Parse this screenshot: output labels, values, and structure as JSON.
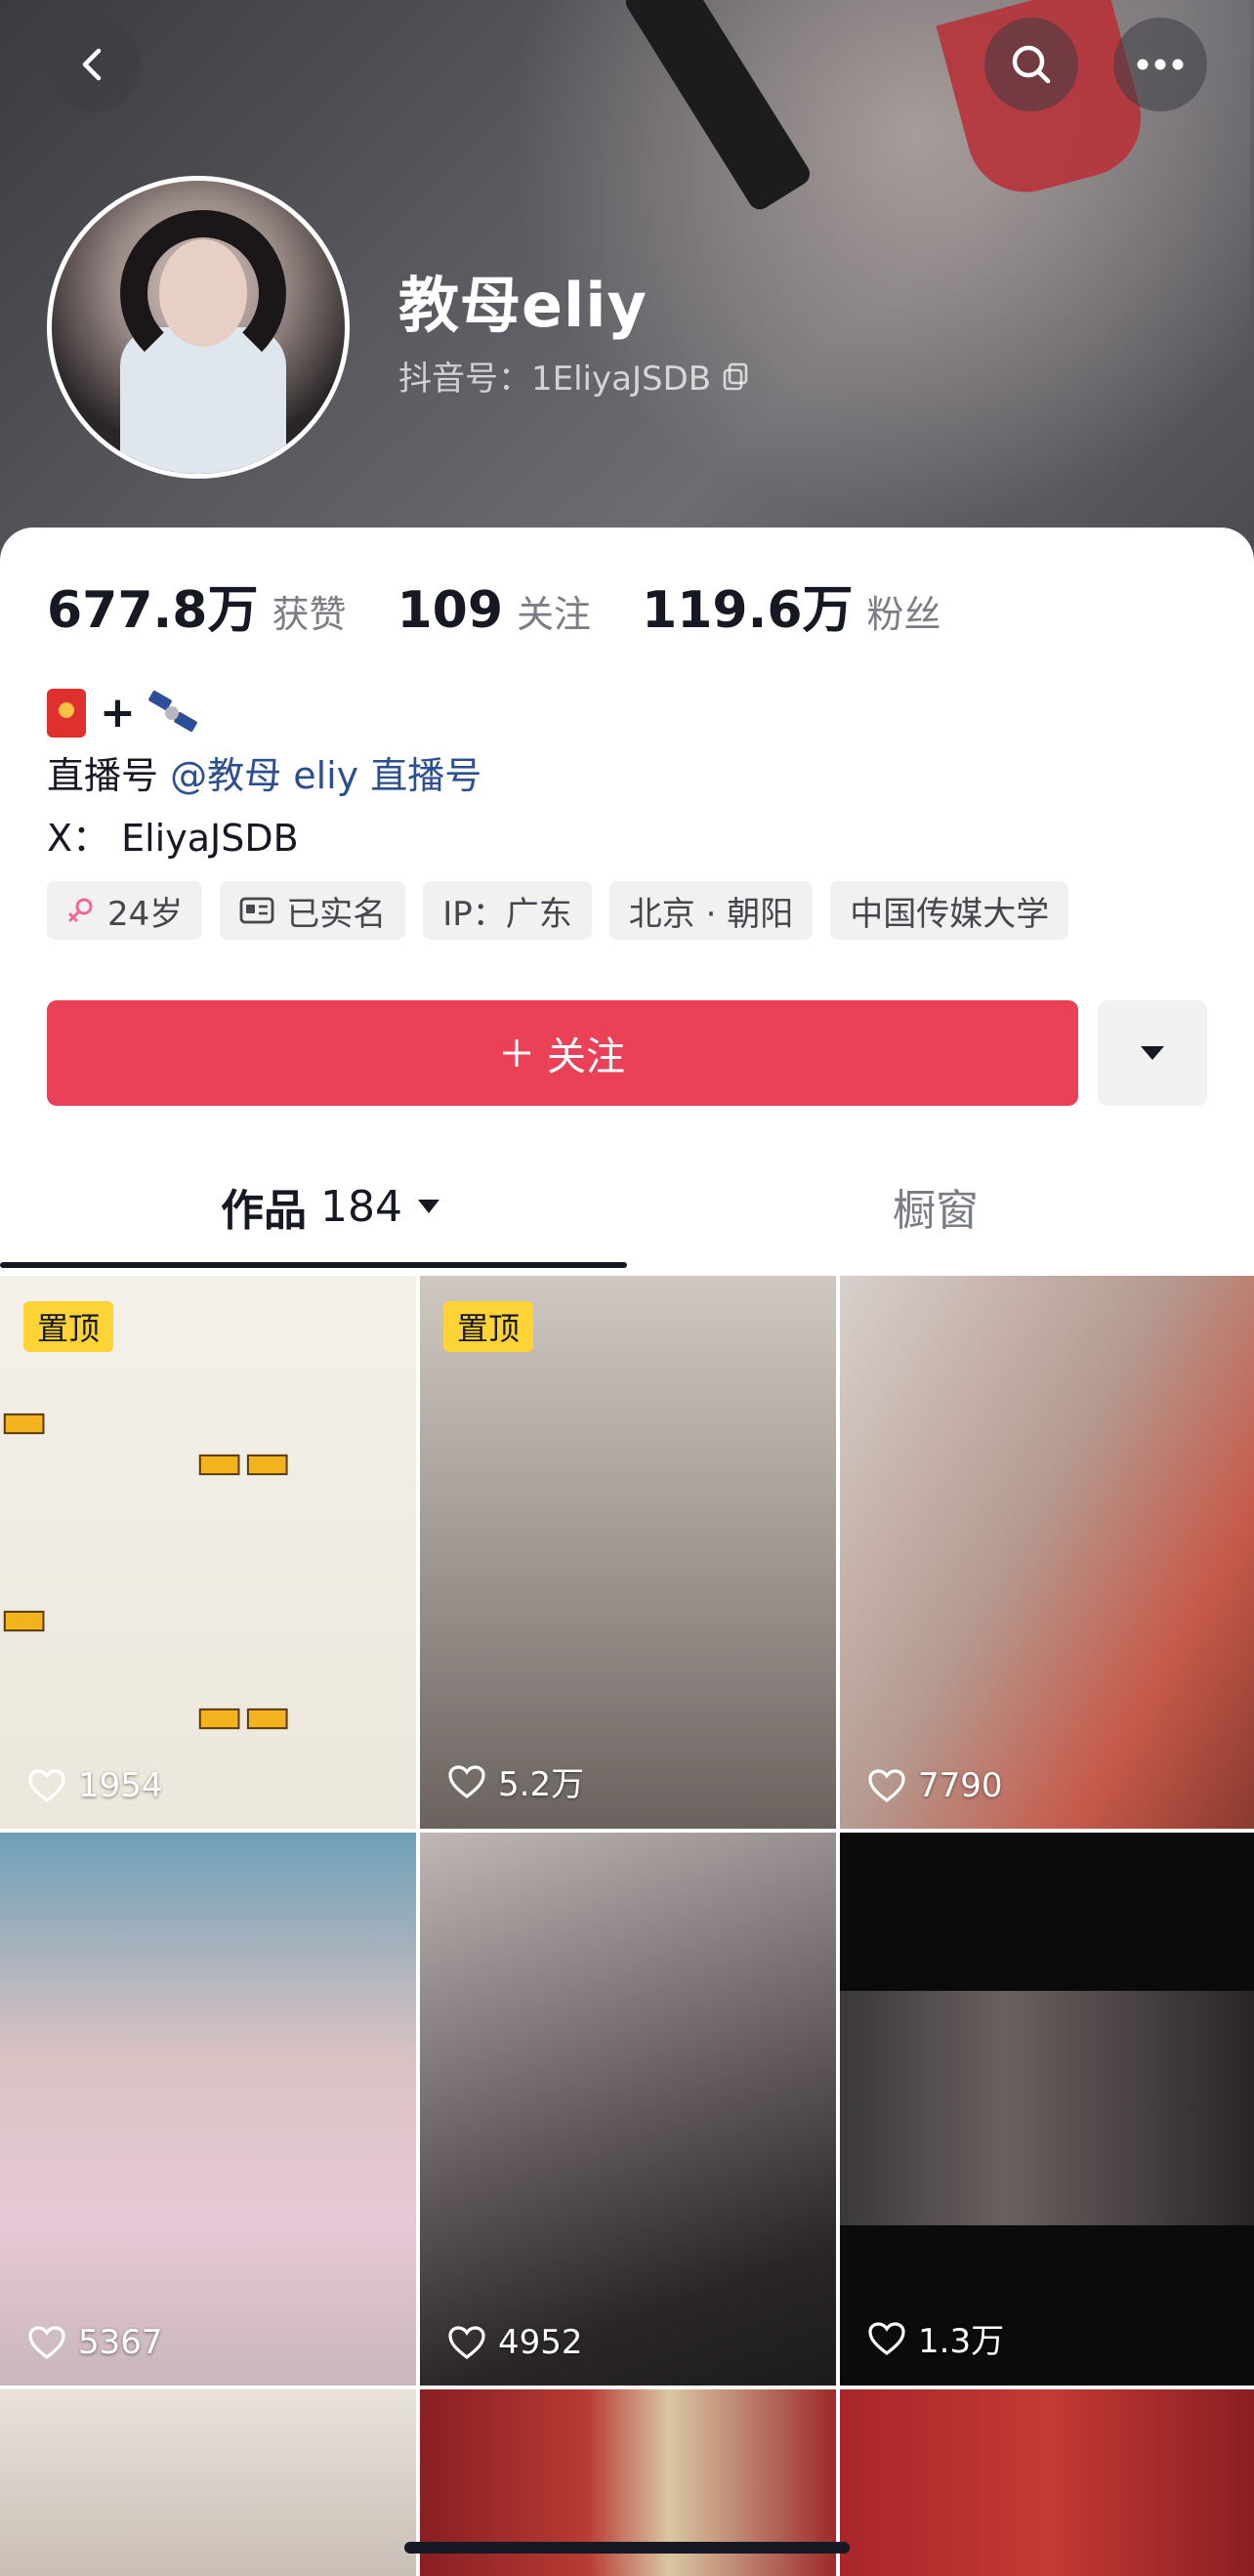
{
  "profile": {
    "name": "教母eliy",
    "douyin_id": "抖音号：1EliyaJSDB"
  },
  "stats": [
    {
      "value": "677.8万",
      "label": "获赞"
    },
    {
      "value": "109",
      "label": "关注"
    },
    {
      "value": "119.6万",
      "label": "粉丝"
    }
  ],
  "bio": {
    "emoji_line": [
      "red-packet-emoji",
      "plus-emoji",
      "satellite-emoji"
    ],
    "live_prefix": "直播号",
    "live_mention": "@教母 eliy 直播号",
    "x_line": "X：  EliyaJSDB"
  },
  "tags": [
    {
      "icon": "female-icon",
      "text": "24岁"
    },
    {
      "icon": "id-card-icon",
      "text": "已实名"
    },
    {
      "icon": "",
      "text": "IP：广东"
    },
    {
      "icon": "",
      "text": "北京 · 朝阳"
    },
    {
      "icon": "",
      "text": "中国传媒大学"
    }
  ],
  "actions": {
    "follow_label": "关注"
  },
  "tabs": {
    "works_label": "作品",
    "works_count": "184",
    "shop_label": "橱窗"
  },
  "grid": [
    {
      "likes": "1954",
      "pinned": "置顶"
    },
    {
      "likes": "5.2万",
      "pinned": "置顶"
    },
    {
      "likes": "7790"
    },
    {
      "likes": "5367"
    },
    {
      "likes": "4952"
    },
    {
      "likes": "1.3万"
    }
  ],
  "colors": {
    "accent": "#ea4058",
    "pin_badge": "#fdd335",
    "mention": "#2b4f8f"
  }
}
